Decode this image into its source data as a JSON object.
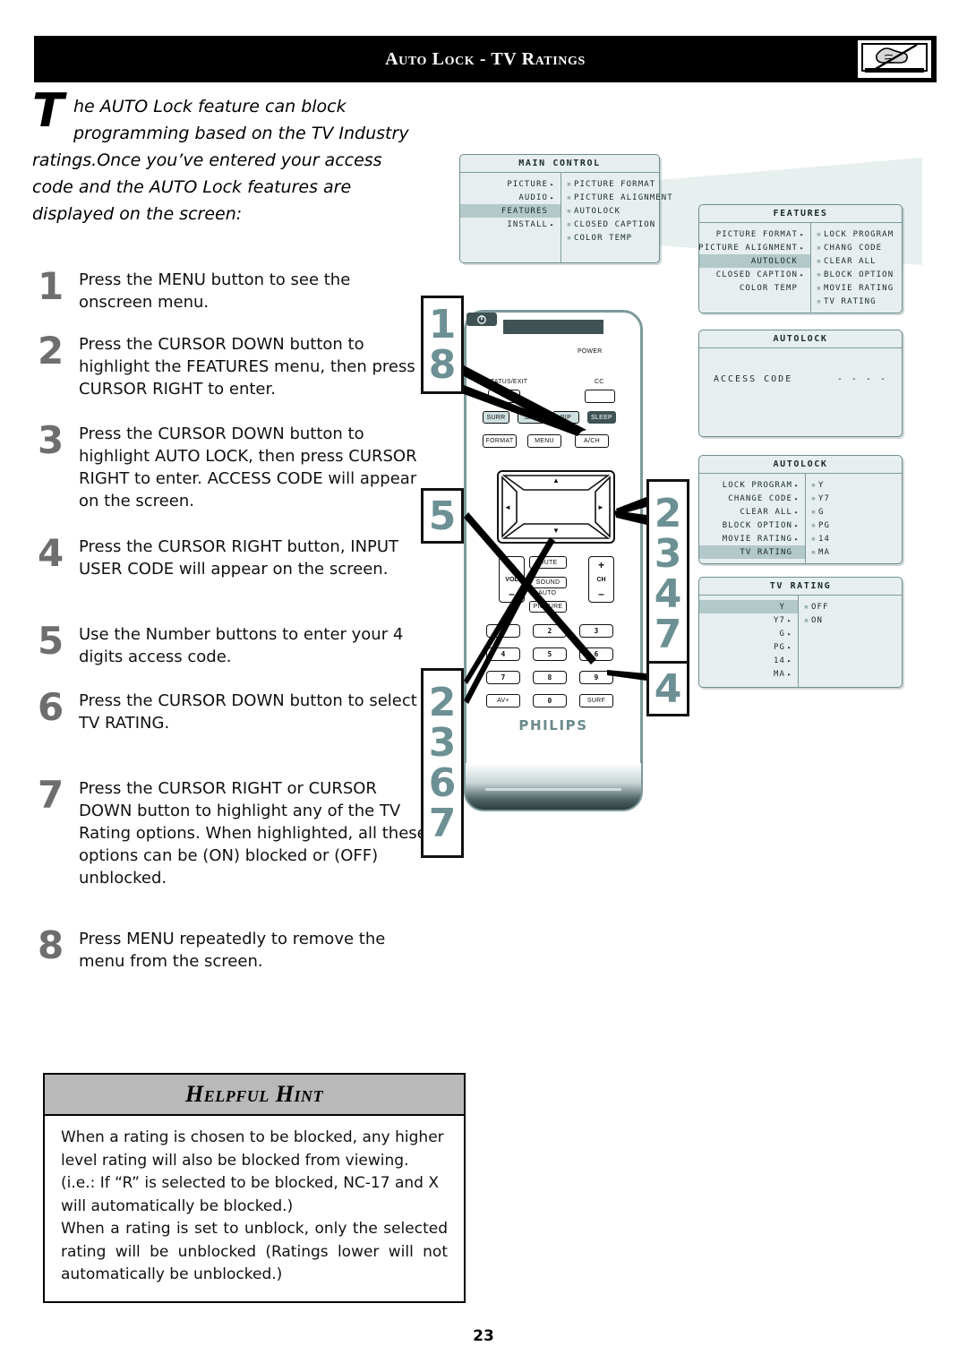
{
  "header": {
    "title": "Auto Lock - TV Ratings",
    "icon": "tv-no-hand-icon"
  },
  "intro": {
    "dropcap": "T",
    "line1": "he AUTO Lock feature can block",
    "line2": "programming based on the TV Industry",
    "rest": "ratings.Once you’ve entered your access code and the AUTO Lock features are displayed on the screen:"
  },
  "steps": [
    {
      "num": "1",
      "text": "Press the MENU button to see the onscreen menu."
    },
    {
      "num": "2",
      "text": "Press the CURSOR DOWN  button to highlight the FEATURES menu, then press CURSOR RIGHT to enter."
    },
    {
      "num": "3",
      "text": "Press the CURSOR DOWN button to highlight AUTO LOCK, then press CURSOR RIGHT to enter. ACCESS CODE will appear on the screen."
    },
    {
      "num": "4",
      "text": "Press the  CURSOR RIGHT button, INPUT USER CODE will appear on the screen."
    },
    {
      "num": "5",
      "text": "Use the Number buttons to enter your 4 digits access code."
    },
    {
      "num": "6",
      "text": "Press the CURSOR DOWN button to select TV RATING."
    },
    {
      "num": "7",
      "text": "Press the CURSOR RIGHT or CURSOR DOWN button to highlight any of the TV Rating options. When highlighted, all these options can be (ON) blocked or (OFF) unblocked."
    },
    {
      "num": "8",
      "text": "Press MENU repeatedly to remove the menu from the screen."
    }
  ],
  "callouts": {
    "left_top": [
      "1",
      "8"
    ],
    "left_mid": [
      "5"
    ],
    "left_bottom": [
      "2",
      "3",
      "6",
      "7"
    ],
    "right_top": [
      "2",
      "3",
      "4",
      "7"
    ],
    "right_bottom": [
      "4"
    ]
  },
  "remote": {
    "brand": "PHILIPS",
    "power_label": "POWER",
    "power_icon": "power-icon",
    "status_exit_label": "STATUS/EXIT",
    "cc_label": "CC",
    "row_feature": [
      "SURR",
      "SAP",
      "PIP",
      "SLEEP"
    ],
    "row_format": [
      "FORMAT",
      "MENU",
      "A/CH"
    ],
    "dpad": {
      "up": "▲",
      "down": "▼",
      "left": "◄",
      "right": "►"
    },
    "mute_label": "MUTE",
    "sound_label": "SOUND",
    "auto_label": "AUTO",
    "picture_label": "PICTURE",
    "vol_label": "VOL",
    "ch_label": "CH",
    "plus": "+",
    "minus": "–",
    "keypad": [
      "1",
      "2",
      "3",
      "4",
      "5",
      "6",
      "7",
      "8",
      "9",
      "AV+",
      "0",
      "SURF"
    ]
  },
  "osd": {
    "main_control": {
      "title": "MAIN CONTROL",
      "left_items": [
        {
          "label": "PICTURE",
          "arrow": true,
          "highlight": false
        },
        {
          "label": "AUDIO",
          "arrow": true,
          "highlight": false
        },
        {
          "label": "FEATURES",
          "arrow": false,
          "highlight": true
        },
        {
          "label": "INSTALL",
          "arrow": true,
          "highlight": false
        }
      ],
      "right_items": [
        "PICTURE FORMAT",
        "PICTURE ALIGNMENT",
        "AUTOLOCK",
        "CLOSED CAPTION",
        "COLOR TEMP"
      ]
    },
    "features": {
      "title": "FEATURES",
      "left_items": [
        {
          "label": "PICTURE FORMAT",
          "arrow": true,
          "highlight": false
        },
        {
          "label": "PICTURE ALIGNMENT",
          "arrow": true,
          "highlight": false
        },
        {
          "label": "AUTOLOCK",
          "arrow": false,
          "highlight": true
        },
        {
          "label": "CLOSED CAPTION",
          "arrow": true,
          "highlight": false
        },
        {
          "label": "COLOR TEMP",
          "arrow": false,
          "highlight": false
        }
      ],
      "right_items": [
        "LOCK PROGRAM",
        "CHANG CODE",
        "CLEAR ALL",
        "BLOCK OPTION",
        "MOVIE RATING",
        "TV RATING"
      ]
    },
    "autolock_access": {
      "title": "AUTOLOCK",
      "field_label": "ACCESS CODE",
      "field_value": "- - - -"
    },
    "autolock": {
      "title": "AUTOLOCK",
      "left_items": [
        {
          "label": "LOCK PROGRAM",
          "arrow": true,
          "highlight": false
        },
        {
          "label": "CHANGE CODE",
          "arrow": true,
          "highlight": false
        },
        {
          "label": "CLEAR ALL",
          "arrow": true,
          "highlight": false
        },
        {
          "label": "BLOCK OPTION",
          "arrow": true,
          "highlight": false
        },
        {
          "label": "MOVIE RATING",
          "arrow": true,
          "highlight": false
        },
        {
          "label": "TV RATING",
          "arrow": false,
          "highlight": true
        }
      ],
      "right_items": [
        "Y",
        "Y7",
        "G",
        "PG",
        "14",
        "MA"
      ]
    },
    "tv_rating": {
      "title": "TV RATING",
      "left_items": [
        {
          "label": "Y",
          "arrow": false,
          "highlight": true
        },
        {
          "label": "Y7",
          "arrow": true,
          "highlight": false
        },
        {
          "label": "G",
          "arrow": true,
          "highlight": false
        },
        {
          "label": "PG",
          "arrow": true,
          "highlight": false
        },
        {
          "label": "14",
          "arrow": true,
          "highlight": false
        },
        {
          "label": "MA",
          "arrow": true,
          "highlight": false
        }
      ],
      "right_items": [
        "OFF",
        "ON"
      ]
    }
  },
  "hint": {
    "title": "Helpful Hint",
    "para1": "When a rating is chosen to be blocked, any higher level rating will also be blocked from viewing. (i.e.: If “R” is selected to be blocked, NC-17 and X will automatically be blocked.)",
    "para2": "When a rating is set to unblock, only the selected rating will be unblocked (Ratings lower will not automatically be unblocked.)"
  },
  "page_number": "23",
  "colors": {
    "accent_teal": "#6c9093",
    "osd_bg": "#e7eeef",
    "osd_highlight": "#b3c8c9",
    "step_number": "#6e6e6e",
    "hint_header": "#b9b9b9"
  }
}
